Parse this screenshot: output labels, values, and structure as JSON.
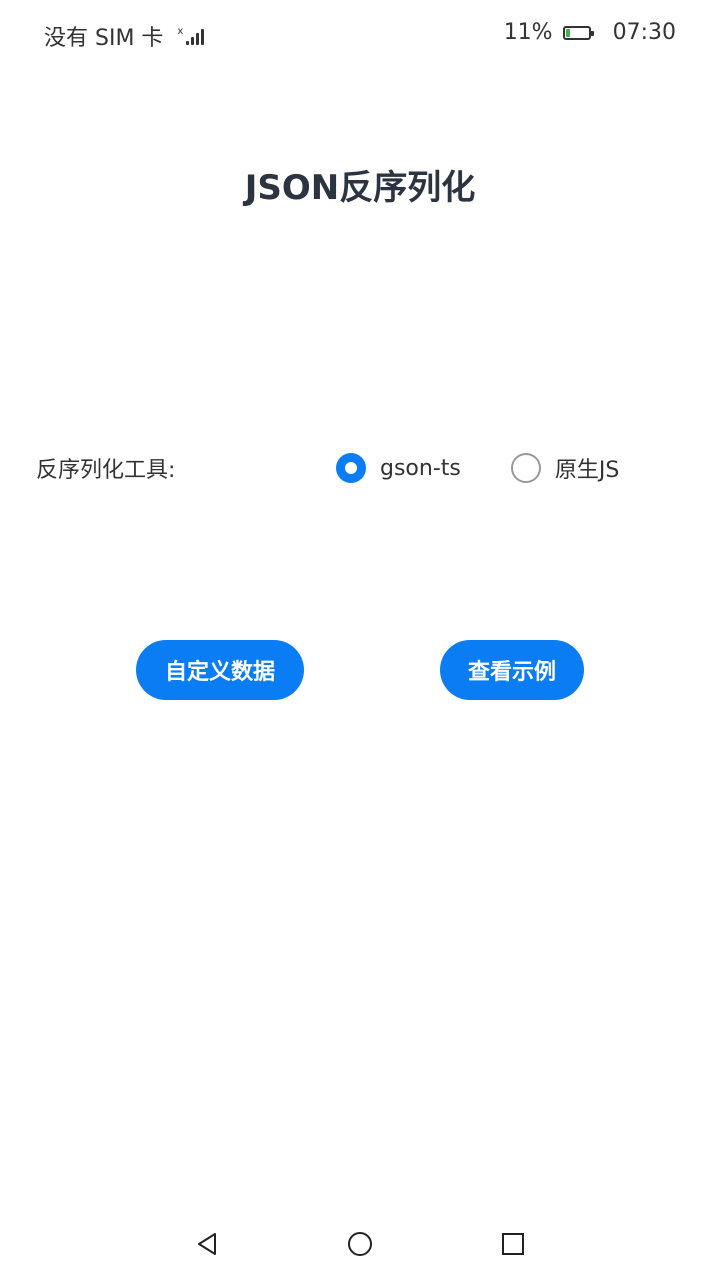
{
  "status_bar": {
    "carrier": "没有 SIM 卡",
    "battery_percent": "11%",
    "battery_level": 0.11,
    "time": "07:30",
    "signal_icon": "signal-no-sim-icon",
    "battery_icon": "battery-icon"
  },
  "page": {
    "title": "JSON反序列化"
  },
  "tool_select": {
    "label": "反序列化工具:",
    "options": [
      {
        "label": "gson-ts",
        "checked": true
      },
      {
        "label": "原生JS",
        "checked": false
      }
    ]
  },
  "buttons": {
    "custom_data": "自定义数据",
    "view_example": "查看示例"
  },
  "colors": {
    "accent": "#0a7df5",
    "title": "#2b3440",
    "battery_fill": "#39b54a"
  },
  "nav_bar": {
    "back_icon": "back-triangle-icon",
    "home_icon": "home-circle-icon",
    "recent_icon": "recent-square-icon"
  }
}
